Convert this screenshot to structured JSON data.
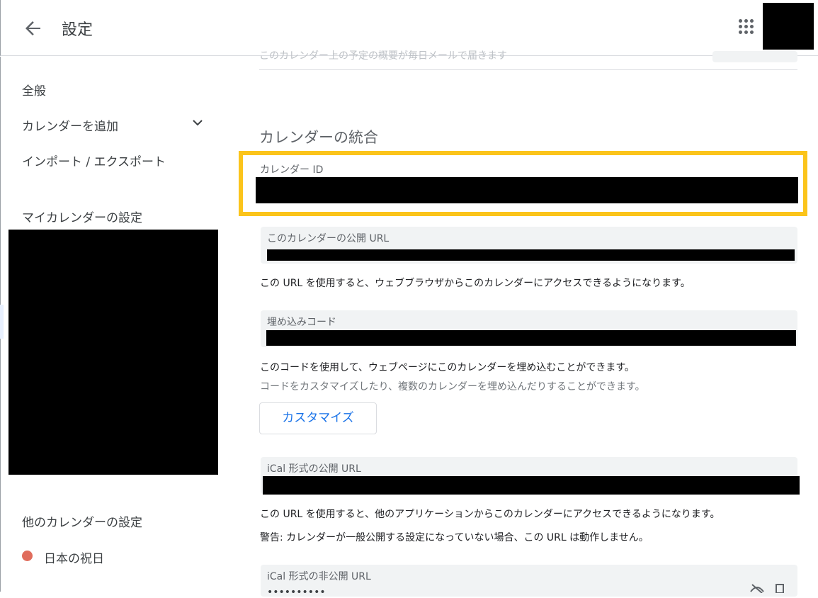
{
  "header": {
    "title": "設定",
    "back_icon": "arrow-back-icon",
    "apps_icon": "apps-grid-icon"
  },
  "sidebar": {
    "items": [
      {
        "label": "全般"
      },
      {
        "label": "カレンダーを追加"
      },
      {
        "label": "インポート / エクスポート"
      }
    ],
    "my_calendars_title": "マイカレンダーの設定",
    "other_calendars_title": "他のカレンダーの設定",
    "other_calendars": [
      {
        "label": "日本の祝日",
        "color": "#e06c5c"
      }
    ]
  },
  "main": {
    "faded_text": "このカレンダー上の予定の概要が毎日メールで届きます",
    "section_title": "カレンダーの統合",
    "calendar_id": {
      "label": "カレンダー ID"
    },
    "public_url": {
      "label": "このカレンダーの公開 URL",
      "desc": "この URL を使用すると、ウェブブラウザからこのカレンダーにアクセスできるようになります。"
    },
    "embed": {
      "label": "埋め込みコード",
      "desc": "このコードを使用して、ウェブページにこのカレンダーを埋め込むことができます。",
      "subdesc": "コードをカスタマイズしたり、複数のカレンダーを埋め込んだりすることができます。",
      "customize_label": "カスタマイズ"
    },
    "ical_public": {
      "label": "iCal 形式の公開 URL",
      "desc": "この URL を使用すると、他のアプリケーションからこのカレンダーにアクセスできるようになります。",
      "warning": "警告: カレンダーが一般公開する設定になっていない場合、この URL は動作しません。"
    },
    "ical_private": {
      "label": "iCal 形式の非公開 URL",
      "value": "••••••••••"
    }
  },
  "colors": {
    "highlight": "#fbc41b",
    "accent": "#1a73e8"
  }
}
